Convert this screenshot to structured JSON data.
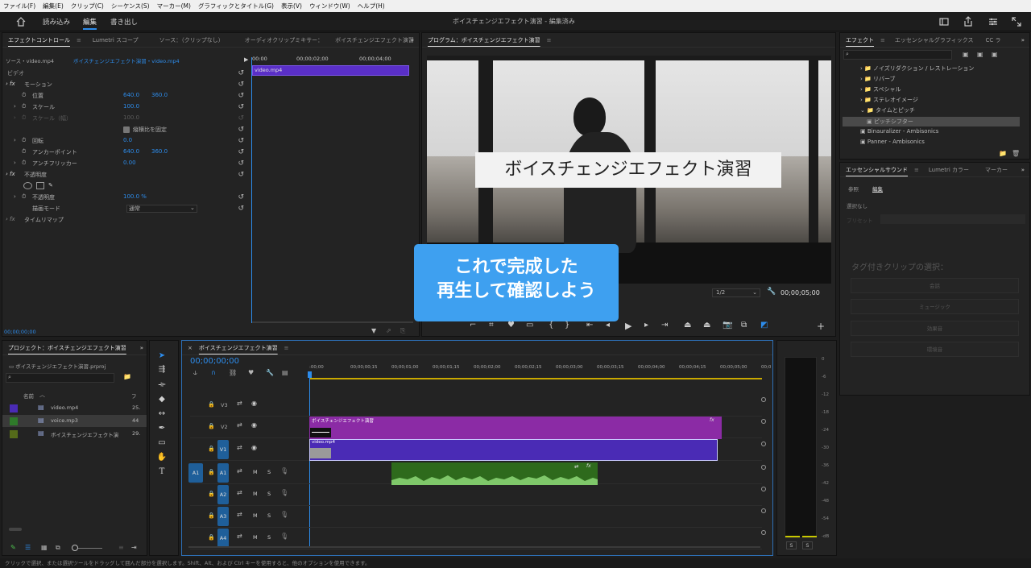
{
  "menubar": [
    "ファイル(F)",
    "編集(E)",
    "クリップ(C)",
    "シーケンス(S)",
    "マーカー(M)",
    "グラフィックとタイトル(G)",
    "表示(V)",
    "ウィンドウ(W)",
    "ヘルプ(H)"
  ],
  "workspaces": {
    "import": "読み込み",
    "edit": "編集",
    "export": "書き出し"
  },
  "project_title": "ボイスチェンジエフェクト演習 - 編集済み",
  "effect_controls": {
    "tabs": [
      "エフェクトコントロール",
      "Lumetri スコープ",
      "ソース：（クリップなし）",
      "オーディオクリップミキサー：",
      "ボイスチェンジエフェクト演習"
    ],
    "source_label": "ソース・video.mp4",
    "seq_label": "ボイスチェンジエフェクト演習・video.mp4",
    "t0": "00:00",
    "t1": "00;00;02;00",
    "t2": "00;00;04;00",
    "clip": "video.mp4",
    "section_video": "ビデオ",
    "motion": "モーション",
    "position": "位置",
    "pos_x": "640.0",
    "pos_y": "360.0",
    "scale": "スケール",
    "scale_val": "100.0",
    "scale_w": "スケール（幅）",
    "scale_w_val": "100.0",
    "uniform": "縦横比を固定",
    "rotation": "回転",
    "rotation_val": "0.0",
    "anchor": "アンカーポイント",
    "anchor_x": "640.0",
    "anchor_y": "360.0",
    "flicker": "アンチフリッカー",
    "flicker_val": "0.00",
    "opacity_section": "不透明度",
    "opacity": "不透明度",
    "opacity_val": "100.0 %",
    "blend": "描画モード",
    "blend_val": "通常",
    "remap": "タイムリマップ",
    "timecode": "00;00;00;00"
  },
  "program": {
    "title": "プログラム：ボイスチェンジエフェクト演習",
    "overlay_title": "ボイスチェンジエフェクト演習",
    "caption_l1": "これで完成した",
    "caption_l2": "再生して確認しよう",
    "resolution": "1/2",
    "timecode": "00;00;05;00"
  },
  "effects": {
    "tabs": [
      "エフェクト",
      "エッセンシャルグラフィックス",
      "CC ラ"
    ],
    "items": [
      "ノイズリダクション / レストレーション",
      "リバーブ",
      "スペシャル",
      "ステレオイメージ",
      "タイムとピッチ",
      "ピッチシフター",
      "Binauralizer - Ambisonics",
      "Panner - Ambisonics"
    ]
  },
  "essential_sound": {
    "tabs": [
      "エッセンシャルサウンド",
      "Lumetri カラー",
      "マーカー"
    ],
    "sub_browse": "参照",
    "sub_edit": "編集",
    "none": "選択なし",
    "preset": "プリセット",
    "prompt": "タグ付きクリップの選択：",
    "buttons": [
      "会話",
      "ミュージック",
      "効果音",
      "環境音"
    ]
  },
  "project": {
    "tabs": [
      "プロジェクト：ボイスチェンジエフェクト演習"
    ],
    "file": "ボイスチェンジエフェクト演習.prproj",
    "col_name": "名前",
    "col_fr": "フ",
    "items": [
      {
        "name": "video.mp4",
        "fr": "25.",
        "color": "#4a2bb5"
      },
      {
        "name": "voice.mp3",
        "fr": "44",
        "color": "#2f7a2a"
      },
      {
        "name": "ボイスチェンジエフェクト演",
        "fr": "29.",
        "color": "#556b1a"
      }
    ]
  },
  "timeline": {
    "title": "ボイスチェンジエフェクト演習",
    "timecode": "00;00;00;00",
    "ruler": [
      ":00;00",
      "00;00;00;15",
      "00;00;01;00",
      "00;00;01;15",
      "00;00;02;00",
      "00;00;02;15",
      "00;00;03;00",
      "00;00;03;15",
      "00;00;04;00",
      "00;00;04;15",
      "00;00;05;00",
      "00;0"
    ],
    "tracks": [
      "V3",
      "V2",
      "V1",
      "A1",
      "A2",
      "A3",
      "A4"
    ],
    "source_a1": "A1",
    "clip_title": "ボイスチェンジエフェクト演習",
    "clip_video": "video.mp4",
    "fx": "fx",
    "mute": "M",
    "solo": "S"
  },
  "meter": {
    "scale": [
      "0",
      "-6",
      "-12",
      "-18",
      "-24",
      "-30",
      "-36",
      "-42",
      "-48",
      "-54",
      "-dB"
    ],
    "s": "S"
  },
  "status": "クリックで選択、または選択ツールをドラッグして囲んだ部分を選択します。Shift、Alt、および Ctrl キーを使用すると、他のオプションを使用できます。",
  "colors": {
    "accent": "#2d8ceb",
    "seq_clip": "#8b2ba5",
    "video_clip": "#4a2bb5",
    "audio_clip": "#2e6a1c",
    "caption": "#3ea0f0"
  }
}
